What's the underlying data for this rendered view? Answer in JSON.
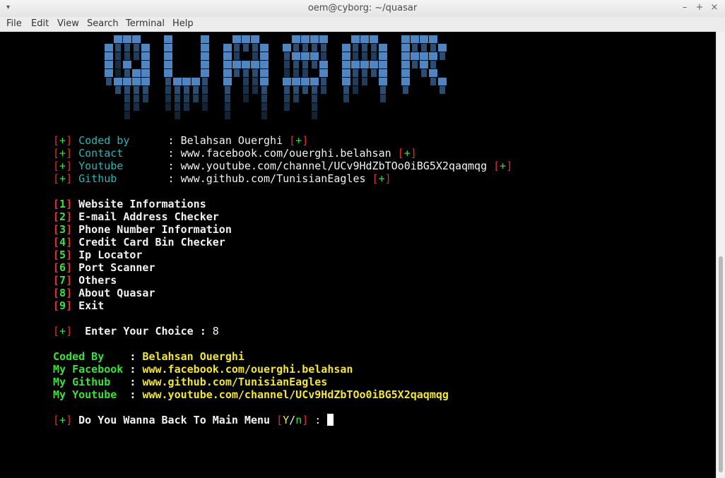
{
  "window": {
    "title": "oem@cyborg: ~/quasar",
    "menu_arrow": "▾",
    "controls": {
      "minimize": "–",
      "maximize": "+",
      "close": "×"
    }
  },
  "menubar": {
    "items": [
      "File",
      "Edit",
      "View",
      "Search",
      "Terminal",
      "Help"
    ]
  },
  "banner": {
    "text": "QUASAR",
    "color": "#4f86c0"
  },
  "credits": [
    {
      "label": "Coded by",
      "value": "Belahsan Ouerghi"
    },
    {
      "label": "Contact",
      "value": "www.facebook.com/ouerghi.belahsan"
    },
    {
      "label": "Youtube",
      "value": "www.youtube.com/channel/UCv9HdZbTOo0iBG5X2qaqmqg"
    },
    {
      "label": "Github",
      "value": "www.github.com/TunisianEagles"
    }
  ],
  "credit_marker": "+",
  "menu_options": [
    {
      "num": "1",
      "label": "Website Informations"
    },
    {
      "num": "2",
      "label": "E-mail Address Checker"
    },
    {
      "num": "3",
      "label": "Phone Number Information"
    },
    {
      "num": "4",
      "label": "Credit Card Bin Checker"
    },
    {
      "num": "5",
      "label": "Ip Locator"
    },
    {
      "num": "6",
      "label": "Port Scanner"
    },
    {
      "num": "7",
      "label": "Others"
    },
    {
      "num": "8",
      "label": "About Quasar"
    },
    {
      "num": "9",
      "label": "Exit"
    }
  ],
  "choice_prompt": {
    "marker": "+",
    "label": "Enter Your Choice :",
    "value": "8"
  },
  "about": [
    {
      "label": "Coded By   ",
      "value": "Belahsan Ouerghi"
    },
    {
      "label": "My Facebook",
      "value": "www.facebook.com/ouerghi.belahsan"
    },
    {
      "label": "My Github  ",
      "value": "www.github.com/TunisianEagles"
    },
    {
      "label": "My Youtube ",
      "value": "www.youtube.com/channel/UCv9HdZbTOo0iBG5X2qaqmqg"
    }
  ],
  "back_prompt": {
    "marker": "+",
    "label": "Do You Wanna Back To Main Menu",
    "yes": "Y",
    "no": "n",
    "colon": ":"
  }
}
